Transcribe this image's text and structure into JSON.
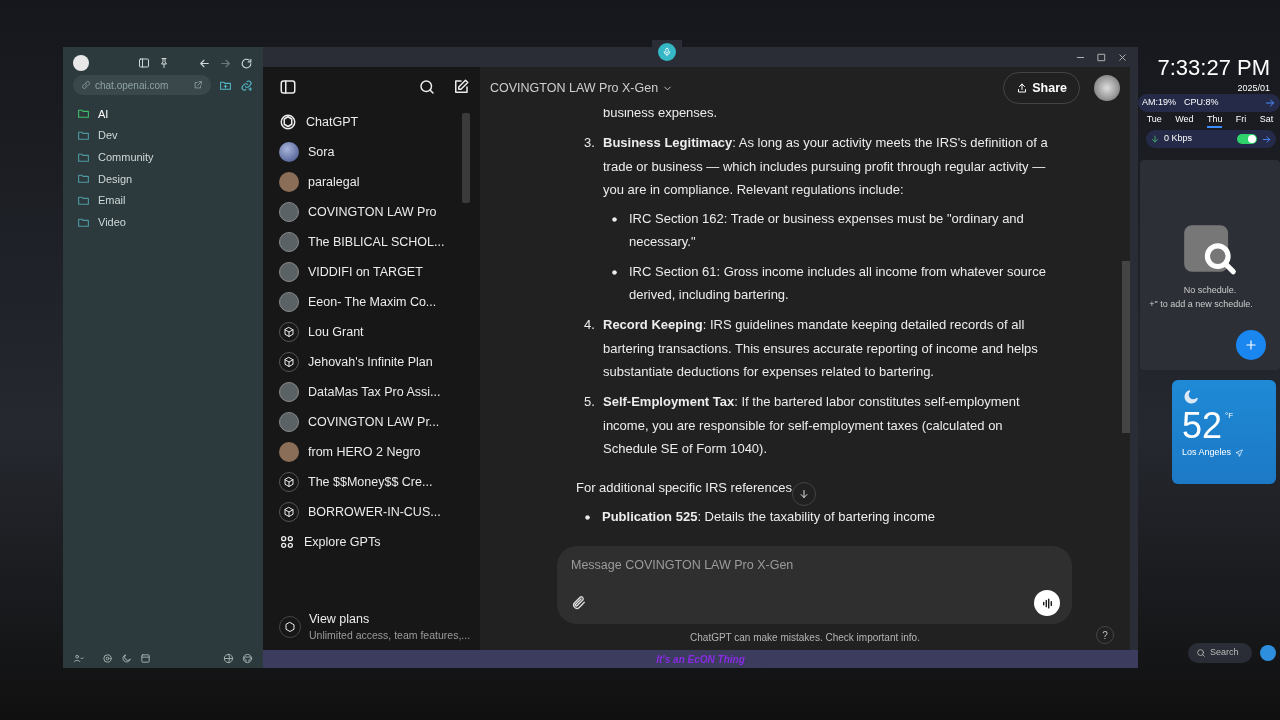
{
  "browser": {
    "url": "chat.openai.com",
    "folders": [
      {
        "label": "AI",
        "selected": true
      },
      {
        "label": "Dev",
        "selected": false
      },
      {
        "label": "Community",
        "selected": false
      },
      {
        "label": "Design",
        "selected": false
      },
      {
        "label": "Email",
        "selected": false
      },
      {
        "label": "Video",
        "selected": false
      }
    ]
  },
  "gpt_sidebar": {
    "items": [
      {
        "label": "ChatGPT",
        "kind": "logo"
      },
      {
        "label": "Sora",
        "kind": "sphere"
      },
      {
        "label": "paralegal",
        "kind": "photo"
      },
      {
        "label": "COVINGTON LAW Pro",
        "kind": "emblem"
      },
      {
        "label": "The BIBLICAL SCHOL...",
        "kind": "emblem"
      },
      {
        "label": "VIDDIFI on TARGET",
        "kind": "emblem"
      },
      {
        "label": "Eeon- The Maxim Co...",
        "kind": "emblem"
      },
      {
        "label": "Lou Grant",
        "kind": "cube"
      },
      {
        "label": "Jehovah's Infinite Plan",
        "kind": "cube"
      },
      {
        "label": "DataMas Tax Pro Assi...",
        "kind": "emblem"
      },
      {
        "label": "COVINGTON LAW Pr...",
        "kind": "emblem"
      },
      {
        "label": "from HERO 2 Negro",
        "kind": "photo"
      },
      {
        "label": "The $$Money$$ Cre...",
        "kind": "cube"
      },
      {
        "label": "BORROWER-IN-CUS...",
        "kind": "cube"
      },
      {
        "label": "Explore GPTs",
        "kind": "explore"
      }
    ],
    "plans": {
      "title": "View plans",
      "subtitle": "Unlimited access, team features,..."
    }
  },
  "chat": {
    "title": "COVINGTON LAW Pro X-Gen",
    "share": "Share",
    "partial_line": "business expenses.",
    "numbered": [
      {
        "number": "3.",
        "text": "**Business Legitimacy**: As long as your activity meets the IRS's definition of a trade or business — which includes pursuing profit through regular activity — you are in compliance. Relevant regulations include:",
        "bullets": [
          "IRC Section 162: Trade or business expenses must be \"ordinary and necessary.\"",
          "IRC Section 61: Gross income includes all income from whatever source derived, including bartering."
        ]
      },
      {
        "number": "4.",
        "text": "**Record Keeping**: IRS guidelines mandate keeping detailed records of all bartering transactions. This ensures accurate reporting of income and helps substantiate deductions for expenses related to bartering."
      },
      {
        "number": "5.",
        "text": "**Self-Employment Tax**: If the bartered labor constitutes self-employment income, you are responsible for self-employment taxes (calculated on Schedule SE of Form 1040)."
      }
    ],
    "closing": "For additional specific IRS references",
    "last_bullet": "**Publication 525**: Details the taxability of bartering income",
    "composer_placeholder": "Message COVINGTON LAW Pro X-Gen",
    "disclaimer": "ChatGPT can make mistakes. Check important info.",
    "help": "?"
  },
  "caption": "It's an EcON Thing",
  "widgets": {
    "clock": "7:33:27 PM",
    "date": "2025/01",
    "ram": "AM:19%",
    "cpu": "CPU:8%",
    "days": [
      {
        "label": "Tue",
        "selected": false
      },
      {
        "label": "Wed",
        "selected": false
      },
      {
        "label": "Thu",
        "selected": true
      },
      {
        "label": "Fri",
        "selected": false
      },
      {
        "label": "Sat",
        "selected": false
      }
    ],
    "network": "0 Kbps",
    "network_on": true,
    "schedule_empty": "No schedule.",
    "schedule_hint": "+\" to add a new schedule.",
    "temperature": "52",
    "unit": "°F",
    "city": "Los Angeles",
    "search": "Search"
  }
}
